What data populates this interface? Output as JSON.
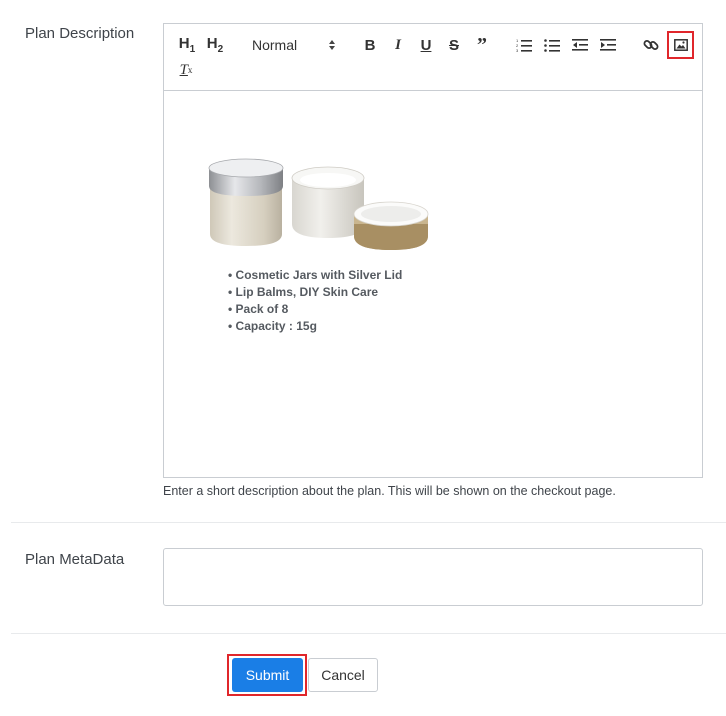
{
  "plan_description": {
    "label": "Plan Description",
    "help_text": "Enter a short description about the plan. This will be shown on the checkout page."
  },
  "toolbar": {
    "h1": "H1",
    "h2": "H2",
    "format_select": "Normal",
    "icons": [
      "heading-1-icon",
      "heading-2-icon",
      "bold-icon",
      "italic-icon",
      "underline-icon",
      "strikethrough-icon",
      "blockquote-icon",
      "ordered-list-icon",
      "bullet-list-icon",
      "outdent-icon",
      "indent-icon",
      "link-icon",
      "image-icon",
      "clear-format-icon"
    ],
    "highlight_color": "#e0262b"
  },
  "content": {
    "image_alt": "cosmetic jars",
    "bullets": [
      "Cosmetic Jars with Silver Lid",
      "Lip Balms, DIY Skin Care",
      "Pack of 8",
      "Capacity : 15g"
    ]
  },
  "plan_metadata": {
    "label": "Plan MetaData",
    "value": ""
  },
  "actions": {
    "submit_label": "Submit",
    "cancel_label": "Cancel",
    "submit_color": "#1a7ee6"
  }
}
